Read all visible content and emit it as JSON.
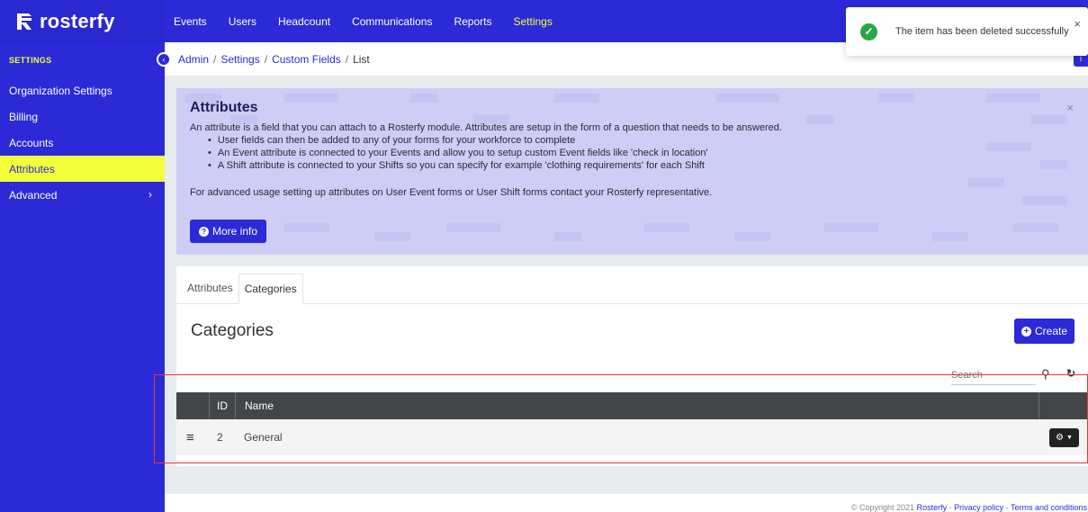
{
  "brand": {
    "name": "rosterfy"
  },
  "topnav": {
    "items": [
      {
        "label": "Events"
      },
      {
        "label": "Users"
      },
      {
        "label": "Headcount"
      },
      {
        "label": "Communications"
      },
      {
        "label": "Reports"
      },
      {
        "label": "Settings",
        "active": true
      }
    ]
  },
  "sidebar": {
    "heading": "SETTINGS",
    "items": [
      {
        "label": "Organization Settings"
      },
      {
        "label": "Billing"
      },
      {
        "label": "Accounts"
      },
      {
        "label": "Attributes",
        "active": true
      },
      {
        "label": "Advanced",
        "chevron": "›"
      }
    ]
  },
  "breadcrumb": {
    "items": [
      "Admin",
      "Settings",
      "Custom Fields",
      "List"
    ],
    "separator": "/"
  },
  "toast": {
    "message": "The item has been deleted successfully",
    "close": "×"
  },
  "info_panel": {
    "title": "Attributes",
    "intro": "An attribute is a field that you can attach to a Rosterfy module. Attributes are setup in the form of a question that needs to be answered.",
    "bullets": [
      "User fields can then be added to any of your forms for your workforce to complete",
      "An Event attribute is connected to your Events and allow you to setup custom Event fields like 'check in location'",
      "A Shift attribute is connected to your Shifts so you can specify for example 'clothing requirements' for each Shift"
    ],
    "footer": "For advanced usage setting up attributes on User Event forms or User Shift forms contact your Rosterfy representative.",
    "more_info_label": "More info",
    "close": "×"
  },
  "tabs": [
    {
      "label": "Attributes"
    },
    {
      "label": "Categories",
      "active": true
    }
  ],
  "main": {
    "title": "Categories",
    "create_label": "Create",
    "search_placeholder": "Search"
  },
  "table": {
    "columns": [
      "ID",
      "Name"
    ],
    "rows": [
      {
        "id": "2",
        "name": "General"
      }
    ]
  },
  "footer": {
    "copyright": "© Copyright 2021 ",
    "brand_link": "Rosterfy",
    "sep1": " - ",
    "privacy": "Privacy policy",
    "sep2": " - ",
    "terms": "Terms and conditions"
  },
  "colors": {
    "brand": "#2b2ad6",
    "accent": "#f2ff3a",
    "success": "#28a745"
  }
}
